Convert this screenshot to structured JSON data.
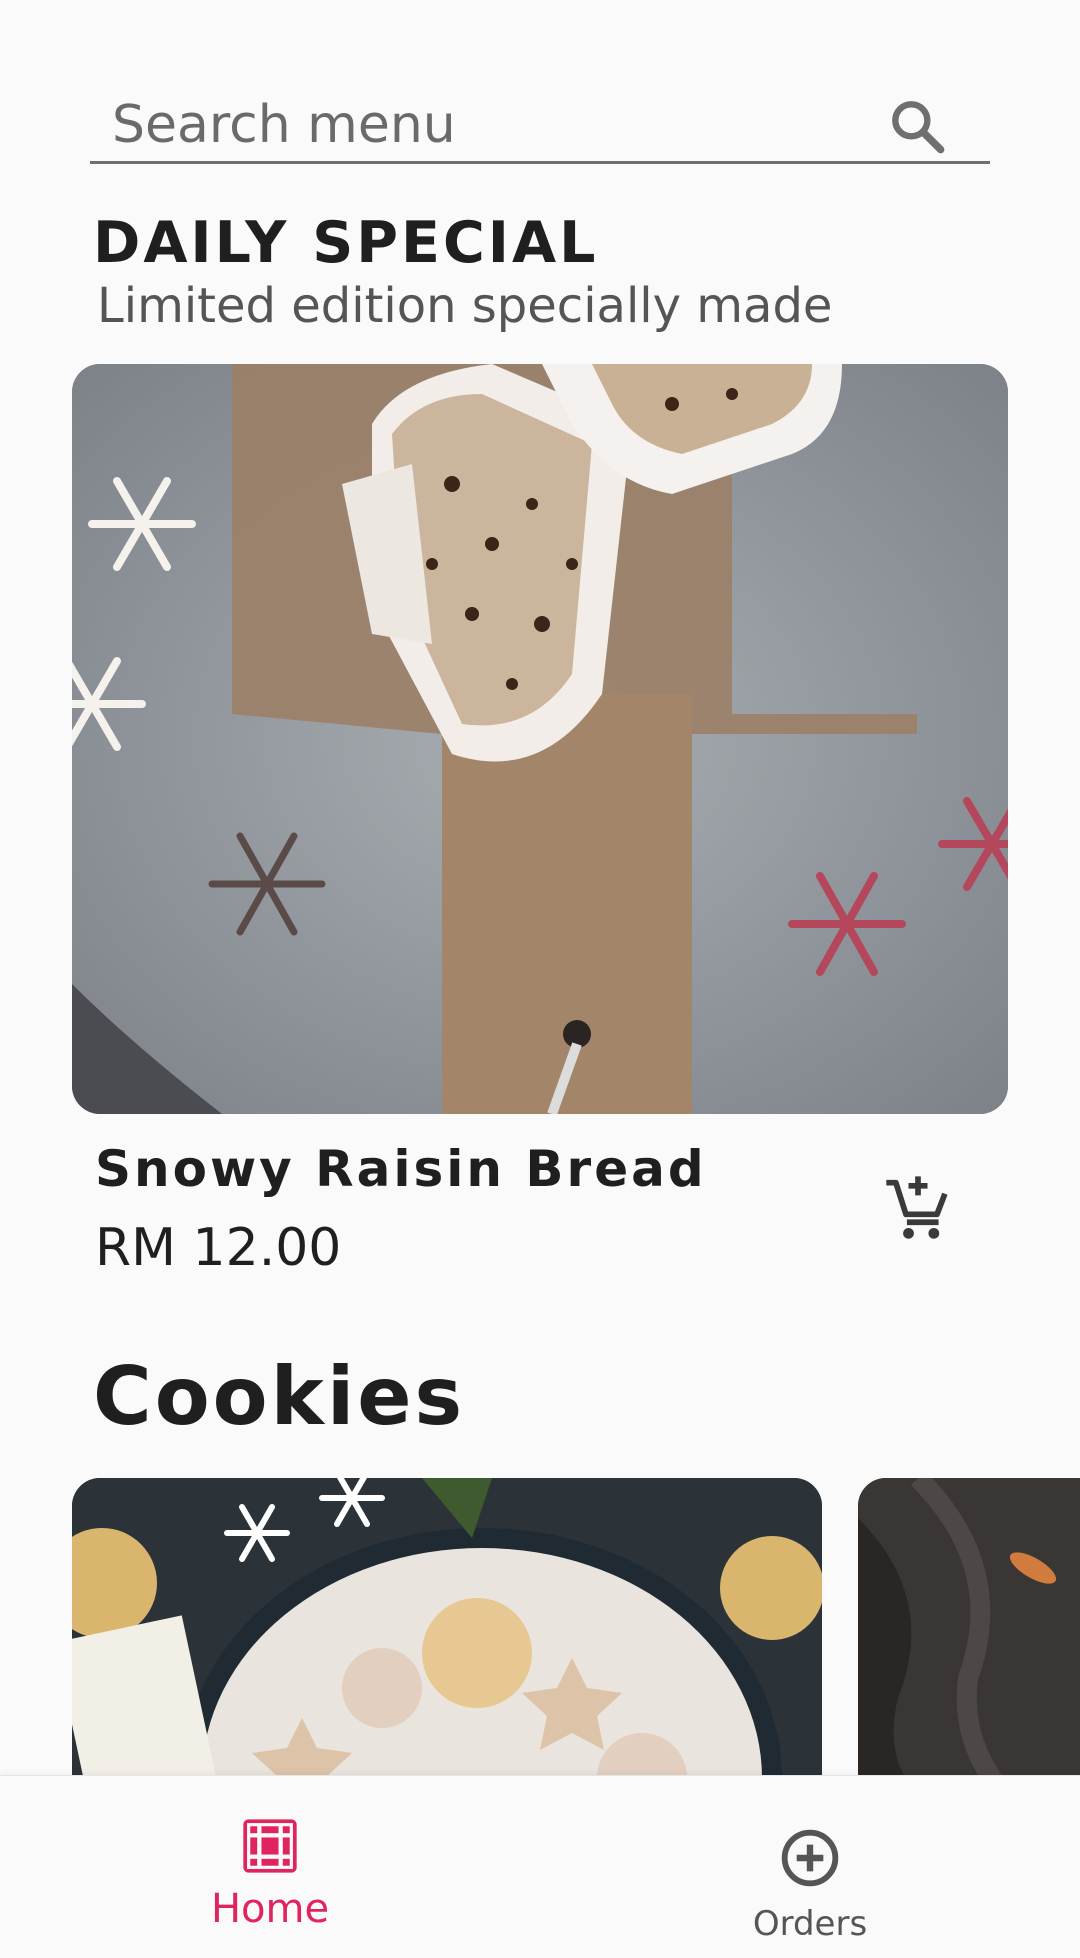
{
  "search": {
    "placeholder": "Search menu"
  },
  "daily_special": {
    "title": "DAILY SPECIAL",
    "subtitle": "Limited edition specially made",
    "item": {
      "name": "Snowy Raisin Bread",
      "price": "RM 12.00"
    }
  },
  "cookies": {
    "title": "Cookies"
  },
  "bottom_nav": {
    "items": [
      {
        "label": "Home",
        "icon": "grid-icon",
        "active": true
      },
      {
        "label": "Orders",
        "icon": "add-circle-icon",
        "active": false
      }
    ]
  },
  "colors": {
    "accent": "#e0245e",
    "background": "#fafafa",
    "text_primary": "#1f1f1f",
    "text_secondary": "#555555"
  }
}
